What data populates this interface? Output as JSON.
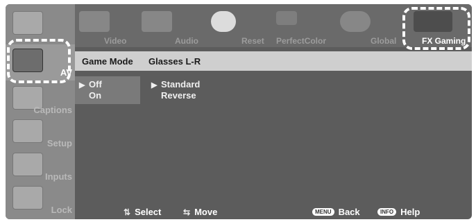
{
  "sidebar": {
    "items": [
      {
        "label": "",
        "icon": "photo-icon"
      },
      {
        "label": "AV",
        "icon": "speakers-icon"
      },
      {
        "label": "Captions",
        "icon": "cc-icon"
      },
      {
        "label": "Setup",
        "icon": "tv-icon"
      },
      {
        "label": "Inputs",
        "icon": "inputs-icon"
      },
      {
        "label": "Lock",
        "icon": "lock-icon"
      }
    ],
    "selected": "AV"
  },
  "tabs": [
    {
      "label": "Video",
      "icon": "tv-icon"
    },
    {
      "label": "Audio",
      "icon": "speaker-icon"
    },
    {
      "label": "Reset",
      "icon": "reset-icon"
    },
    {
      "label": "PerfectColor",
      "icon": "color-bars-icon"
    },
    {
      "label": "Global",
      "icon": "speakers-icon"
    },
    {
      "label": "FX Gaming",
      "icon": "gamepad-icon"
    }
  ],
  "selected_tab": "FX Gaming",
  "menu": {
    "col1_header": "Game Mode",
    "col2_header": "Glasses L-R",
    "col1_options": [
      "Off",
      "On"
    ],
    "col1_selected": "Off",
    "col2_options": [
      "Standard",
      "Reverse"
    ],
    "col2_selected": "Standard"
  },
  "footer": {
    "select_label": "Select",
    "move_label": "Move",
    "back_key": "MENU",
    "back_label": "Back",
    "help_key": "INFO",
    "help_label": "Help"
  },
  "colors": {
    "background": "#5c5c5c",
    "sidebar": "#8a8a8a",
    "header_row": "#cfcfcf",
    "highlight": "#ffffff"
  }
}
